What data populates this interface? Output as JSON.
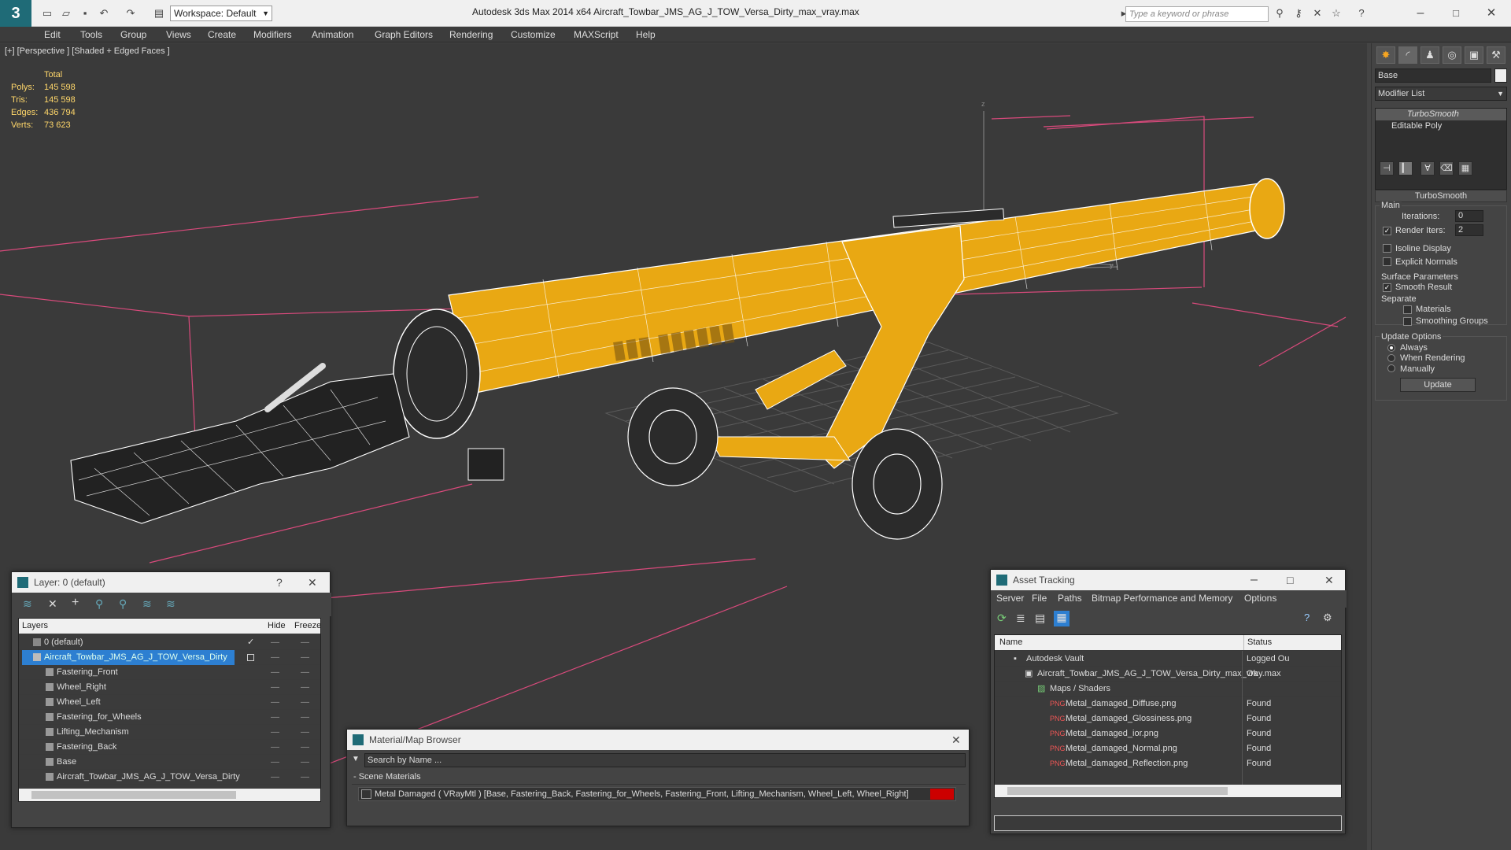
{
  "app": {
    "workspace": "Workspace: Default",
    "title": "Autodesk 3ds Max  2014 x64      Aircraft_Towbar_JMS_AG_J_TOW_Versa_Dirty_max_vray.max",
    "search_placeholder": "Type a keyword or phrase"
  },
  "menu": [
    "Edit",
    "Tools",
    "Group",
    "Views",
    "Create",
    "Modifiers",
    "Animation",
    "Graph Editors",
    "Rendering",
    "Customize",
    "MAXScript",
    "Help"
  ],
  "viewport": {
    "label": "[+] [Perspective ] [Shaded + Edged Faces ]",
    "stats": {
      "header": "Total",
      "polys_label": "Polys:",
      "polys": "145 598",
      "tris_label": "Tris:",
      "tris": "145 598",
      "edges_label": "Edges:",
      "edges": "436 794",
      "verts_label": "Verts:",
      "verts": "73 623"
    },
    "axis": {
      "z": "z",
      "x": "x",
      "y": "y"
    },
    "colors": {
      "body": "#e9a813",
      "wire": "#ffffff",
      "frame": "#e0578a"
    }
  },
  "command_panel": {
    "object_name": "Base",
    "modifier_list": "Modifier List",
    "stack": [
      "TurboSmooth",
      "Editable Poly"
    ],
    "rollout": "TurboSmooth",
    "main": "Main",
    "iterations_label": "Iterations:",
    "iterations": "0",
    "render_iters_label": "Render Iters:",
    "render_iters": "2",
    "isoline": "Isoline Display",
    "explicit": "Explicit Normals",
    "surface": "Surface Parameters",
    "smooth": "Smooth Result",
    "separate": "Separate",
    "materials": "Materials",
    "smoothing_groups": "Smoothing Groups",
    "update_options": "Update Options",
    "always": "Always",
    "when_rendering": "When Rendering",
    "manually": "Manually",
    "update_btn": "Update"
  },
  "layer_window": {
    "title": "Layer: 0 (default)",
    "help": "?",
    "col_layers": "Layers",
    "col_hide": "Hide",
    "col_freeze": "Freeze",
    "rows": [
      "0 (default)",
      "Aircraft_Towbar_JMS_AG_J_TOW_Versa_Dirty",
      "Fastering_Front",
      "Wheel_Right",
      "Wheel_Left",
      "Fastering_for_Wheels",
      "Lifting_Mechanism",
      "Fastering_Back",
      "Base",
      "Aircraft_Towbar_JMS_AG_J_TOW_Versa_Dirty"
    ]
  },
  "material_browser": {
    "title": "Material/Map Browser",
    "search": "Search by Name ...",
    "section": "- Scene Materials",
    "material": "Metal Damaged  ( VRayMtl ) [Base, Fastering_Back, Fastering_for_Wheels, Fastering_Front, Lifting_Mechanism, Wheel_Left, Wheel_Right]"
  },
  "asset_tracking": {
    "title": "Asset Tracking",
    "menu": [
      "Server",
      "File",
      "Paths",
      "Bitmap Performance and Memory",
      "Options"
    ],
    "col_name": "Name",
    "col_status": "Status",
    "rows": [
      {
        "name": "Autodesk Vault",
        "status": "Logged Ou"
      },
      {
        "name": "Aircraft_Towbar_JMS_AG_J_TOW_Versa_Dirty_max_vray.max",
        "status": "Ok"
      },
      {
        "name": "Maps / Shaders",
        "status": ""
      },
      {
        "name": "Metal_damaged_Diffuse.png",
        "status": "Found"
      },
      {
        "name": "Metal_damaged_Glossiness.png",
        "status": "Found"
      },
      {
        "name": "Metal_damaged_ior.png",
        "status": "Found"
      },
      {
        "name": "Metal_damaged_Normal.png",
        "status": "Found"
      },
      {
        "name": "Metal_damaged_Reflection.png",
        "status": "Found"
      }
    ]
  }
}
